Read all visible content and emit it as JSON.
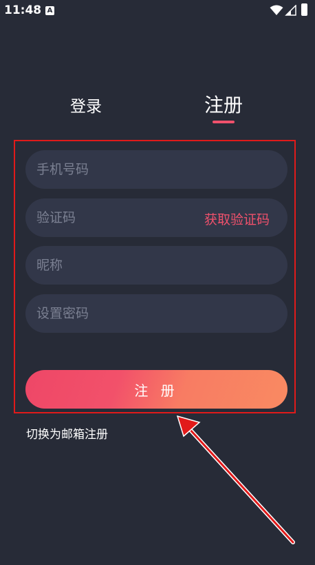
{
  "status_bar": {
    "time": "11:48",
    "notification_badge": "A"
  },
  "tabs": {
    "login_label": "登录",
    "register_label": "注册"
  },
  "form": {
    "phone_placeholder": "手机号码",
    "code_placeholder": "验证码",
    "get_code_label": "获取验证码",
    "nickname_placeholder": "昵称",
    "password_placeholder": "设置密码",
    "submit_label": "注 册"
  },
  "switch_email_label": "切换为邮箱注册",
  "colors": {
    "background": "#272b37",
    "field": "#323749",
    "accent": "#f0516c",
    "gradient_end": "#f98a62",
    "highlight_box": "#e11a1a"
  }
}
